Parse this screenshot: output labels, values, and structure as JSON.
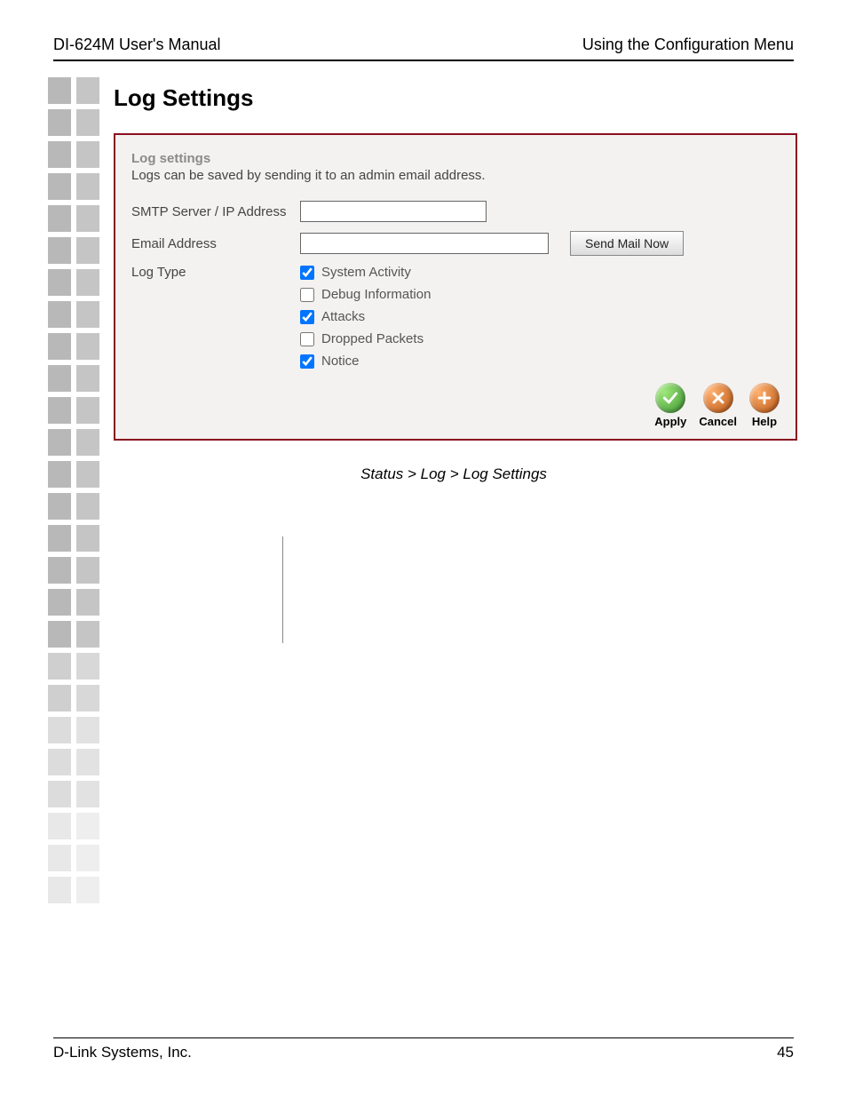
{
  "header": {
    "left": "DI-624M User's Manual",
    "right": "Using the Configuration Menu"
  },
  "section": {
    "title": "Log Settings"
  },
  "panel": {
    "sub_title": "Log settings",
    "desc": "Logs can be saved by sending it to an admin email address.",
    "labels": {
      "smtp": "SMTP Server / IP Address",
      "email": "Email Address",
      "log_type": "Log Type"
    },
    "inputs": {
      "smtp_value": "",
      "email_value": ""
    },
    "buttons": {
      "send_mail": "Send Mail Now"
    },
    "log_types": [
      {
        "label": "System Activity",
        "checked": true
      },
      {
        "label": "Debug Information",
        "checked": false
      },
      {
        "label": "Attacks",
        "checked": true
      },
      {
        "label": "Dropped Packets",
        "checked": false
      },
      {
        "label": "Notice",
        "checked": true
      }
    ],
    "actions": {
      "apply": "Apply",
      "cancel": "Cancel",
      "help": "Help"
    }
  },
  "caption": "Status > Log > Log Settings",
  "footer": {
    "left": "D-Link Systems, Inc.",
    "page": "45"
  },
  "side_colors": {
    "c1a": "#b8b8b8",
    "c1b": "#c5c5c5",
    "f1a": "#cfcfcf",
    "f1b": "#d8d8d8",
    "f2a": "#dcdcdc",
    "f2b": "#e2e2e2",
    "f3a": "#e8e8e8",
    "f3b": "#eeeeee"
  }
}
